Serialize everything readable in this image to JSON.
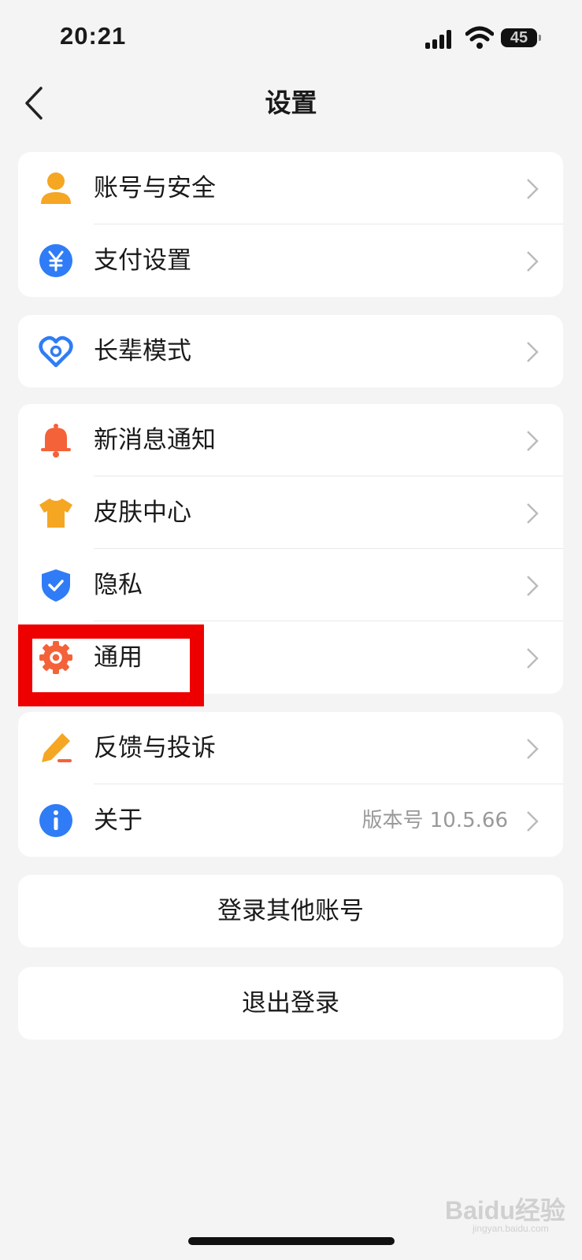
{
  "status_bar": {
    "time": "20:21",
    "battery": "45"
  },
  "nav": {
    "title": "设置"
  },
  "groups": [
    [
      {
        "label": "账号与安全",
        "icon": "user-icon",
        "color": "#f5a623"
      },
      {
        "label": "支付设置",
        "icon": "yuan-icon",
        "color": "#2f7cf6"
      }
    ],
    [
      {
        "label": "长辈模式",
        "icon": "heart-icon",
        "color": "#2f7cf6"
      }
    ],
    [
      {
        "label": "新消息通知",
        "icon": "bell-icon",
        "color": "#f4623a"
      },
      {
        "label": "皮肤中心",
        "icon": "tshirt-icon",
        "color": "#f5a623"
      },
      {
        "label": "隐私",
        "icon": "shield-icon",
        "color": "#2f7cf6"
      },
      {
        "label": "通用",
        "icon": "gear-icon",
        "color": "#f4623a"
      }
    ],
    [
      {
        "label": "反馈与投诉",
        "icon": "pen-icon",
        "color": "#f5a623"
      },
      {
        "label": "关于",
        "icon": "info-icon",
        "color": "#2f7cf6",
        "value": "版本号 10.5.66"
      }
    ]
  ],
  "buttons": {
    "switch_account": "登录其他账号",
    "logout": "退出登录"
  },
  "watermark": {
    "brand": "Baidu经验",
    "url": "jingyan.baidu.com"
  }
}
